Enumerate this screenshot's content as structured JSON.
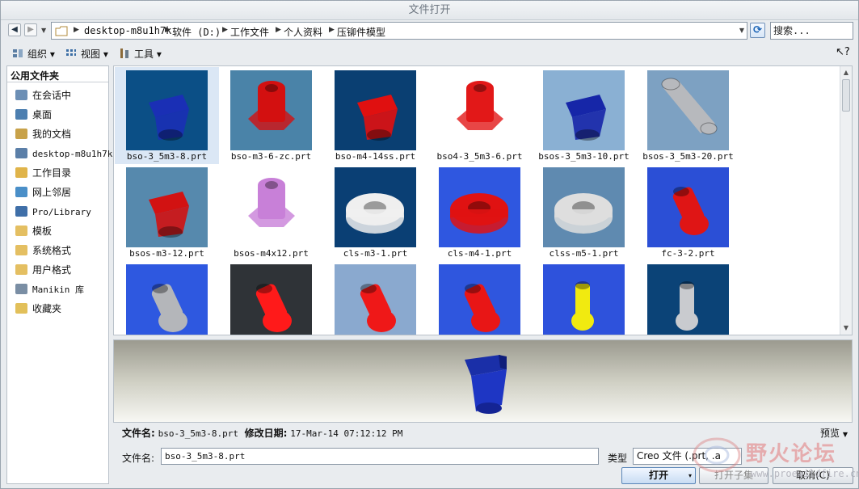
{
  "window": {
    "title": "文件打开"
  },
  "address": {
    "crumbs": [
      "desktop-m8u1h7k",
      "软件 (D:)",
      "工作文件",
      "个人资料",
      "压铆件模型"
    ]
  },
  "search": {
    "placeholder": "搜索..."
  },
  "toolbar": {
    "organize": "组织",
    "view": "视图",
    "tools": "工具"
  },
  "sidebar": {
    "title": "公用文件夹",
    "items": [
      {
        "label": "在会话中",
        "icon": "session-icon"
      },
      {
        "label": "桌面",
        "icon": "desktop-icon"
      },
      {
        "label": "我的文档",
        "icon": "documents-icon"
      },
      {
        "label": "desktop-m8u1h7k",
        "icon": "computer-icon"
      },
      {
        "label": "工作目录",
        "icon": "working-folder-icon"
      },
      {
        "label": "网上邻居",
        "icon": "network-icon"
      },
      {
        "label": "Pro/Library",
        "icon": "library-icon"
      },
      {
        "label": "模板",
        "icon": "folder-icon"
      },
      {
        "label": "系统格式",
        "icon": "folder-icon"
      },
      {
        "label": "用户格式",
        "icon": "folder-icon"
      },
      {
        "label": "Manikin 库",
        "icon": "manikin-icon"
      },
      {
        "label": "收藏夹",
        "icon": "favorites-icon"
      }
    ]
  },
  "files": [
    {
      "name": "bso-3_5m3-8.prt",
      "bg": "#0b4f86",
      "color": "#1a2fb5",
      "shape": "boss",
      "selected": true
    },
    {
      "name": "bso-m3-6-zc.prt",
      "bg": "#4a83a8",
      "color": "#d31010",
      "shape": "hexboss"
    },
    {
      "name": "bso-m4-14ss.prt",
      "bg": "#0a3f72",
      "color": "#e01010",
      "shape": "boss"
    },
    {
      "name": "bso4-3_5m3-6.prt",
      "bg": "#ffffff",
      "color": "#e21818",
      "shape": "hexboss"
    },
    {
      "name": "bsos-3_5m3-10.prt",
      "bg": "#8ab0d3",
      "color": "#1626a8",
      "shape": "boss"
    },
    {
      "name": "bsos-3_5m3-20.prt",
      "bg": "#7da1c2",
      "color": "#b7b9bd",
      "shape": "longboss"
    },
    {
      "name": "bsos-m3-12.prt",
      "bg": "#5689ad",
      "color": "#d21212",
      "shape": "boss"
    },
    {
      "name": "bsos-m4x12.prt",
      "bg": "#ffffff",
      "color": "#c880d8",
      "shape": "hexboss"
    },
    {
      "name": "cls-m3-1.prt",
      "bg": "#0a3f74",
      "color": "#efefef",
      "shape": "ring"
    },
    {
      "name": "cls-m4-1.prt",
      "bg": "#2f57e0",
      "color": "#e01212",
      "shape": "ring"
    },
    {
      "name": "clss-m5-1.prt",
      "bg": "#5f8ab0",
      "color": "#dedede",
      "shape": "ring"
    },
    {
      "name": "fc-3-2.prt",
      "bg": "#2b4fd6",
      "color": "#df1515",
      "shape": "stud"
    },
    {
      "name": "",
      "bg": "#2e58e0",
      "color": "#b4b6ba",
      "shape": "stud"
    },
    {
      "name": "",
      "bg": "#2f3337",
      "color": "#ff1a1a",
      "shape": "stud"
    },
    {
      "name": "",
      "bg": "#8aa9cf",
      "color": "#ef1818",
      "shape": "stud"
    },
    {
      "name": "",
      "bg": "#2f56de",
      "color": "#e81616",
      "shape": "stud"
    },
    {
      "name": "",
      "bg": "#2e52dc",
      "color": "#f1ea10",
      "shape": "pin"
    },
    {
      "name": "",
      "bg": "#0b4377",
      "color": "#c9cbcf",
      "shape": "pin"
    }
  ],
  "info": {
    "filename_label": "文件名:",
    "filename": "bso-3_5m3-8.prt",
    "modified_label": "修改日期:",
    "modified": "17-Mar-14 07:12:12 PM",
    "preview_label": "预览"
  },
  "bottom": {
    "filename_label": "文件名:",
    "filename_value": "bso-3_5m3-8.prt",
    "type_label": "类型",
    "type_value": "Creo 文件 (.prt, .a",
    "open": "打开",
    "open_subset": "打开子集",
    "cancel": "取消(C)"
  },
  "watermark": {
    "text": "野火论坛",
    "url": "www.proewildfire.cn"
  },
  "colors": {
    "accent": "#1a63b5",
    "selected_bg": "#dbe7f5"
  }
}
